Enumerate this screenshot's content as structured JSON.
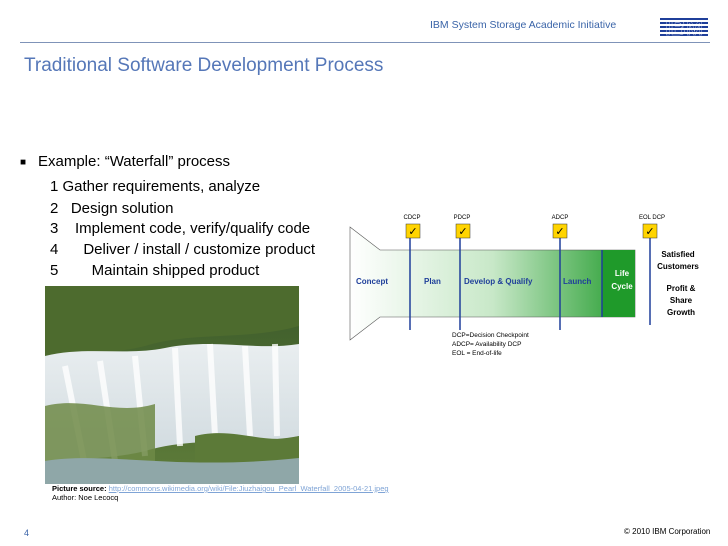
{
  "header": {
    "initiative": "IBM System Storage Academic Initiative",
    "logo": "IBM"
  },
  "title": "Traditional Software Development Process",
  "example": "Example: “Waterfall” process",
  "steps": [
    "1 Gather requirements, analyze",
    "2   Design solution",
    "3    Implement code, verify/qualify code",
    "4      Deliver / install / customize product",
    "5        Maintain shipped product"
  ],
  "image": {
    "icon": "waterfall-photo"
  },
  "source": {
    "label": "Picture source:",
    "url": "http://commons.wikimedia.org/wiki/File:Jiuzhaigou_Pearl_Waterfall_2005-04-21.jpeg",
    "author": "Author: Noe Lecocq"
  },
  "diagram": {
    "checkpoints": [
      "CDCP",
      "PDCP",
      "ADCP",
      "EOL DCP"
    ],
    "phases": [
      "Concept",
      "Plan",
      "Develop & Qualify",
      "Launch"
    ],
    "lifecycle": [
      "Life",
      "Cycle"
    ],
    "outcome1": [
      "Satisfied",
      "Customers"
    ],
    "outcome2": [
      "Profit &",
      "Share",
      "Growth"
    ],
    "legend": [
      "DCP=Decision Checkpoint",
      "ADCP= Availability DCP",
      "EOL = End-of-life"
    ],
    "check_symbol": "✓",
    "colors": {
      "gradient_start": "#ffffff",
      "gradient_end": "#1f9a2a",
      "line": "#1f3f9a",
      "check_box": "#ffd400"
    }
  },
  "footer": {
    "page": "4",
    "copyright": "© 2010 IBM Corporation"
  }
}
